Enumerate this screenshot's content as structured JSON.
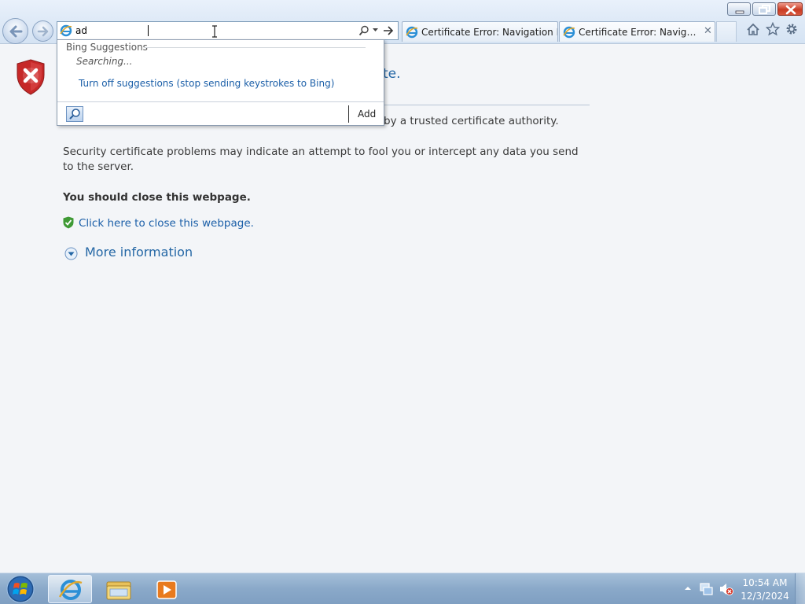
{
  "window": {
    "controls": {
      "minimize_icon": "minimize-icon",
      "restore_icon": "restore-icon",
      "close_icon": "close-icon"
    }
  },
  "navigation": {
    "back_icon": "back-arrow-icon",
    "forward_icon": "forward-arrow-icon"
  },
  "address_bar": {
    "value": "ad",
    "site_icon": "ie-page-icon",
    "search_icon": "search-icon",
    "dropdown_icon": "chevron-down-icon",
    "go_icon": "go-arrow-icon"
  },
  "tabs": [
    {
      "label": "Certificate Error: Navigation Bl...",
      "icon": "ie-page-icon"
    },
    {
      "label": "Certificate Error: Navigatio...",
      "icon": "ie-page-icon",
      "close_icon": "close-icon"
    }
  ],
  "toolbar": {
    "home_icon": "home-icon",
    "favorites_icon": "star-icon",
    "tools_icon": "gear-icon"
  },
  "suggestions": {
    "header": "Bing Suggestions",
    "status": "Searching...",
    "turn_off_link": "Turn off suggestions (stop sending keystrokes to Bing)",
    "add_button": "Add"
  },
  "page": {
    "heading_tail": "te.",
    "para_1_tail": "by a trusted certificate authority.",
    "para_2": "Security certificate problems may indicate an attempt to fool you or intercept any data you send to the server.",
    "close_advice": "You should close this webpage.",
    "close_link": "Click here to close this webpage.",
    "more_info": "More information"
  },
  "taskbar": {
    "items": [
      "Internet Explorer",
      "Windows Explorer",
      "Windows Media Player"
    ],
    "clock": {
      "time": "10:54 AM",
      "date": "12/3/2024"
    }
  },
  "colors": {
    "link": "#1b5fa8",
    "heading": "#2467a5",
    "error_red": "#c62828",
    "shield_green": "#3f9a35"
  }
}
